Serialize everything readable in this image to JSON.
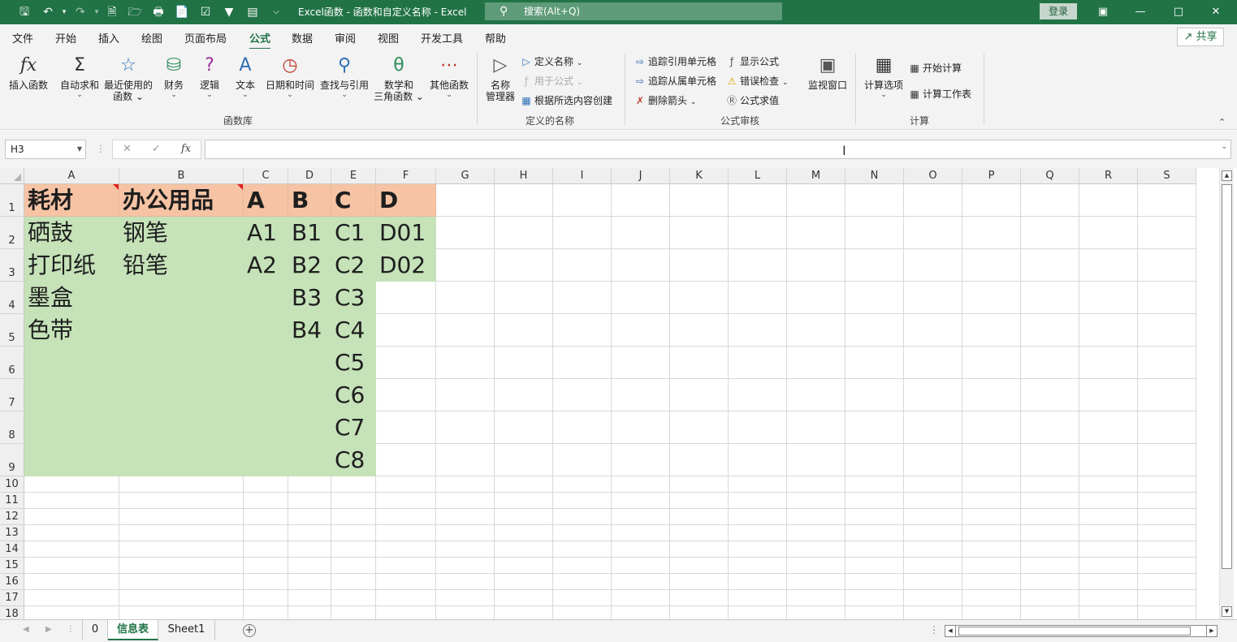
{
  "titlebar": {
    "title": "Excel函数 - 函数和自定义名称  -  Excel",
    "search_placeholder": "搜索(Alt+Q)",
    "login": "登录"
  },
  "menu": {
    "tabs": [
      "文件",
      "开始",
      "插入",
      "绘图",
      "页面布局",
      "公式",
      "数据",
      "审阅",
      "视图",
      "开发工具",
      "帮助"
    ],
    "active": "公式",
    "share": "共享"
  },
  "ribbon": {
    "function_library": {
      "group_label": "函数库",
      "buttons": [
        {
          "label": "插入函数",
          "icon": "fx-icon"
        },
        {
          "label": "自动求和",
          "icon": "sigma-icon"
        },
        {
          "label": "最近使用的\n函数",
          "icon": "star-icon"
        },
        {
          "label": "财务",
          "icon": "database-icon"
        },
        {
          "label": "逻辑",
          "icon": "question-icon"
        },
        {
          "label": "文本",
          "icon": "text-icon"
        },
        {
          "label": "日期和时间",
          "icon": "clock-icon"
        },
        {
          "label": "查找与引用",
          "icon": "magnifier-icon"
        },
        {
          "label": "数学和\n三角函数",
          "icon": "theta-icon"
        },
        {
          "label": "其他函数",
          "icon": "more-icon"
        }
      ]
    },
    "defined_names": {
      "group_label": "定义的名称",
      "manager": "名称\n管理器",
      "define_name": "定义名称",
      "use_in_formula": "用于公式",
      "create_from_selection": "根据所选内容创建"
    },
    "formula_auditing": {
      "group_label": "公式审核",
      "trace_precedents": "追踪引用单元格",
      "trace_dependents": "追踪从属单元格",
      "remove_arrows": "删除箭头",
      "show_formulas": "显示公式",
      "error_checking": "错误检查",
      "evaluate_formula": "公式求值",
      "watch_window": "监视窗口"
    },
    "calculation": {
      "group_label": "计算",
      "options": "计算选项",
      "calc_now": "开始计算",
      "calc_sheet": "计算工作表"
    }
  },
  "formula_bar": {
    "name_box": "H3",
    "formula": ""
  },
  "grid": {
    "columns": [
      "A",
      "B",
      "C",
      "D",
      "E",
      "F",
      "G",
      "H",
      "I",
      "J",
      "K",
      "L",
      "M",
      "N",
      "O",
      "P",
      "Q",
      "R",
      "S"
    ],
    "rows": [
      "1",
      "2",
      "3",
      "4",
      "5",
      "6",
      "7",
      "8",
      "9",
      "10",
      "11",
      "12",
      "13",
      "14",
      "15",
      "16",
      "17",
      "18"
    ],
    "cells": {
      "A1": "耗材",
      "B1": "办公用品",
      "C1": "A",
      "D1": "B",
      "E1": "C",
      "F1": "D",
      "A2": "硒鼓",
      "B2": "钢笔",
      "C2": "A1",
      "D2": "B1",
      "E2": "C1",
      "F2": "D01",
      "A3": "打印纸",
      "B3": "铅笔",
      "C3": "A2",
      "D3": "B2",
      "E3": "C2",
      "F3": "D02",
      "A4": "墨盒",
      "D4": "B3",
      "E4": "C3",
      "A5": "色带",
      "D5": "B4",
      "E5": "C4",
      "E6": "C5",
      "E7": "C6",
      "E8": "C7",
      "E9": "C8"
    },
    "colors": {
      "header_fill": "#f6c4a4",
      "data_fill": "#c5e2b8"
    }
  },
  "sheets": {
    "tabs": [
      "0",
      "信息表",
      "Sheet1"
    ],
    "active": "信息表"
  },
  "theme": {
    "accent": "#217346"
  }
}
